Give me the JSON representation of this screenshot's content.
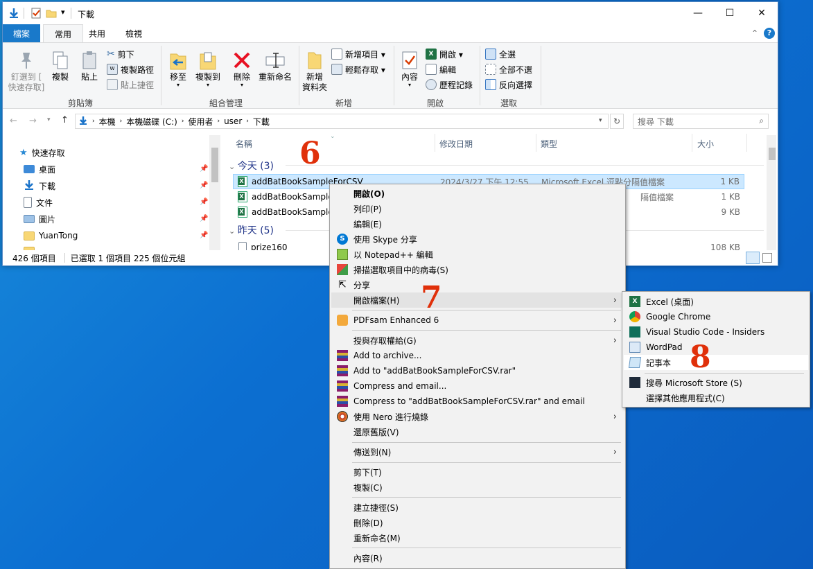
{
  "window": {
    "title": "下載",
    "minimize": "—",
    "maximize": "☐",
    "close": "✕",
    "qat_dropdown": "▾"
  },
  "ribbon_tabs": [
    "檔案",
    "常用",
    "共用",
    "檢視"
  ],
  "ribbon": {
    "clipboard": {
      "pin_label": "釘選到 [",
      "pin_label2": "快速存取]",
      "copy": "複製",
      "paste": "貼上",
      "cut": "剪下",
      "copy_path": "複製路徑",
      "paste_shortcut": "貼上捷徑",
      "group": "剪貼簿"
    },
    "organize": {
      "move_to": "移至",
      "copy_to": "複製到",
      "delete": "刪除",
      "rename": "重新命名",
      "group": "組合管理"
    },
    "new": {
      "new_folder": "新增",
      "new_folder2": "資料夾",
      "new_item": "新增項目 ▾",
      "easy_access": "輕鬆存取 ▾",
      "group": "新增"
    },
    "open": {
      "properties": "內容",
      "open": "開啟 ▾",
      "edit": "編輯",
      "history": "歷程記錄",
      "group": "開啟"
    },
    "select": {
      "select_all": "全選",
      "select_none": "全部不選",
      "invert": "反向選擇",
      "group": "選取"
    }
  },
  "address": {
    "crumbs": [
      "本機",
      "本機磁碟 (C:)",
      "使用者",
      "user",
      "下載"
    ],
    "search_placeholder": "搜尋 下載"
  },
  "nav": {
    "quick_access": "快速存取",
    "items": [
      "桌面",
      "下載",
      "文件",
      "圖片",
      "YuanTong"
    ]
  },
  "columns": {
    "name": "名稱",
    "modified": "修改日期",
    "type": "類型",
    "size": "大小"
  },
  "groups": {
    "today": "今天 (3)",
    "yesterday": "昨天 (5)"
  },
  "files": [
    {
      "name": "addBatBookSampleForCSV",
      "date": "2024/3/27 下午 12:55",
      "type": "Microsoft Excel 逗點分隔值檔案",
      "size": "1 KB"
    },
    {
      "name": "addBatBookSample",
      "type": "隔值檔案",
      "size": "1 KB"
    },
    {
      "name": "addBatBookSample",
      "size": "9 KB"
    },
    {
      "name": "prize160",
      "size": "108 KB"
    }
  ],
  "status": {
    "count": "426 個項目",
    "selected": "已選取 1 個項目  225 個位元組"
  },
  "context_menu": {
    "items": [
      "開啟(O)",
      "列印(P)",
      "編輯(E)",
      "使用 Skype 分享",
      "以 Notepad++ 編輯",
      "掃描選取項目中的病毒(S)",
      "分享",
      "開啟檔案(H)",
      "PDFsam Enhanced 6",
      "授與存取權給(G)",
      "Add to archive...",
      "Add to \"addBatBookSampleForCSV.rar\"",
      "Compress and email...",
      "Compress to \"addBatBookSampleForCSV.rar\" and email",
      "使用 Nero 進行燒錄",
      "還原舊版(V)",
      "傳送到(N)",
      "剪下(T)",
      "複製(C)",
      "建立捷徑(S)",
      "刪除(D)",
      "重新命名(M)",
      "內容(R)"
    ]
  },
  "open_with": {
    "items": [
      "Excel (桌面)",
      "Google Chrome",
      "Visual Studio Code - Insiders",
      "WordPad",
      "記事本",
      "搜尋 Microsoft Store (S)",
      "選擇其他應用程式(C)"
    ]
  },
  "annotations": [
    "6",
    "7",
    "8"
  ]
}
